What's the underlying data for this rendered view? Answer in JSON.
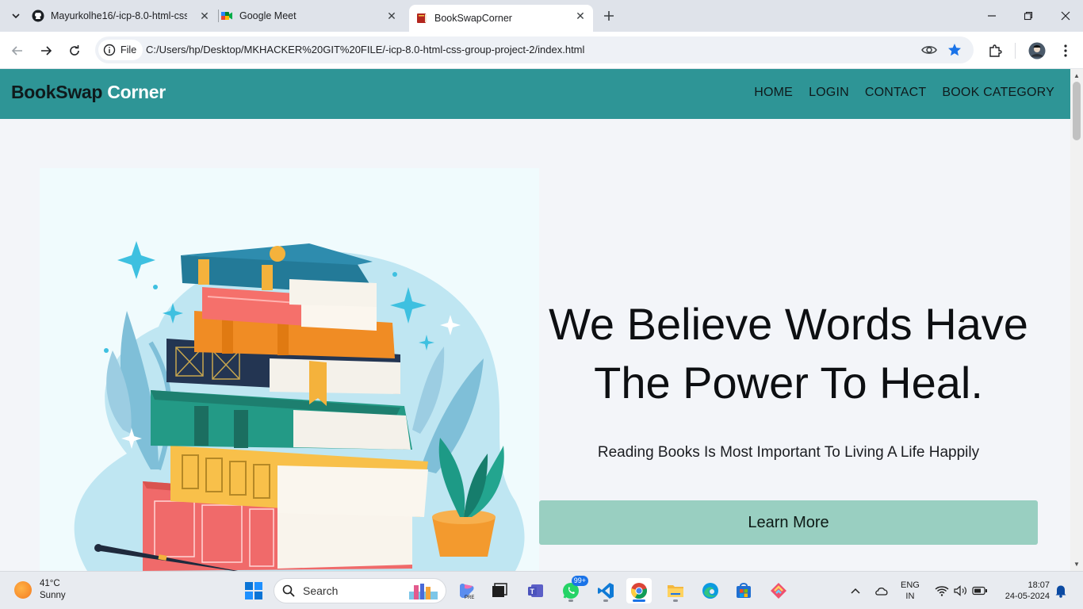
{
  "browser": {
    "tabs": [
      {
        "title": "Mayurkolhe16/-icp-8.0-html-css",
        "icon": "github-icon"
      },
      {
        "title": "Google Meet",
        "icon": "google-meet-icon"
      },
      {
        "title": "BookSwapCorner",
        "icon": "book-favicon-icon",
        "active": true
      }
    ],
    "site_chip": "File",
    "url": "C:/Users/hp/Desktop/MKHACKER%20GIT%20FILE/-icp-8.0-html-css-group-project-2/index.html"
  },
  "page": {
    "brand": {
      "part1": "BookSwap",
      "part2": "Corner"
    },
    "nav": {
      "home": "HOME",
      "login": "LOGIN",
      "contact": "CONTACT",
      "category": "BOOK CATEGORY"
    },
    "hero": {
      "headline_line1": "We Believe Words Have",
      "headline_line2": "The Power To Heal.",
      "subline": "Reading Books Is Most Important To Living A Life Happily",
      "cta": "Learn More"
    }
  },
  "taskbar": {
    "weather": {
      "temp": "41°C",
      "condition": "Sunny"
    },
    "search_label": "Search",
    "whatsapp_badge": "99+",
    "language": {
      "line1": "ENG",
      "line2": "IN"
    },
    "clock": {
      "time": "18:07",
      "date": "24-05-2024"
    }
  },
  "colors": {
    "navbar": "#2e9596",
    "cta": "#99cfc1",
    "page_bg": "#f3f5f9"
  }
}
